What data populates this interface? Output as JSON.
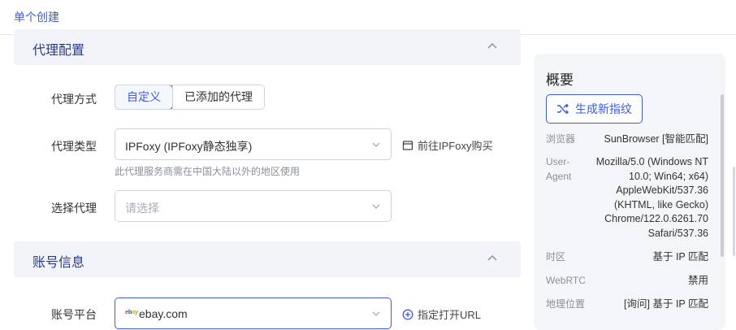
{
  "tabs": {
    "active": "单个创建"
  },
  "proxy_section": {
    "title": "代理配置",
    "method_label": "代理方式",
    "method_options": [
      "自定义",
      "已添加的代理"
    ],
    "type_label": "代理类型",
    "type_value": "IPFoxy (IPFoxy静态独享)",
    "buy_link": "前往IPFoxy购买",
    "type_hint": "此代理服务商需在中国大陆以外的地区使用",
    "select_label": "选择代理",
    "select_placeholder": "请选择"
  },
  "account_section": {
    "title": "账号信息",
    "platform_label": "账号平台",
    "platform_value": "ebay.com",
    "url_link": "指定打开URL"
  },
  "summary": {
    "title": "概要",
    "generate_button": "生成新指纹",
    "rows": [
      {
        "key": "浏览器",
        "value": "SunBrowser [智能匹配]"
      },
      {
        "key": "User-Agent",
        "value": "Mozilla/5.0 (Windows NT 10.0; Win64; x64) AppleWebKit/537.36 (KHTML, like Gecko) Chrome/122.0.6261.70 Safari/537.36"
      },
      {
        "key": "时区",
        "value": "基于 IP 匹配"
      },
      {
        "key": "WebRTC",
        "value": "禁用"
      },
      {
        "key": "地理位置",
        "value": "[询问] 基于 IP 匹配"
      }
    ],
    "ua_lines": [
      "Mozilla/5.0 (Windows NT",
      "10.0; Win64; x64)",
      "AppleWebKit/537.36",
      "(KHTML, like Gecko)",
      "Chrome/122.0.6261.70",
      "Safari/537.36"
    ],
    "ua_key_lines": [
      "User-",
      "Agent"
    ]
  },
  "colors": {
    "accent": "#3d5bd9",
    "section_bg": "#f2f4fa",
    "summary_bg": "#f4f5f8"
  }
}
